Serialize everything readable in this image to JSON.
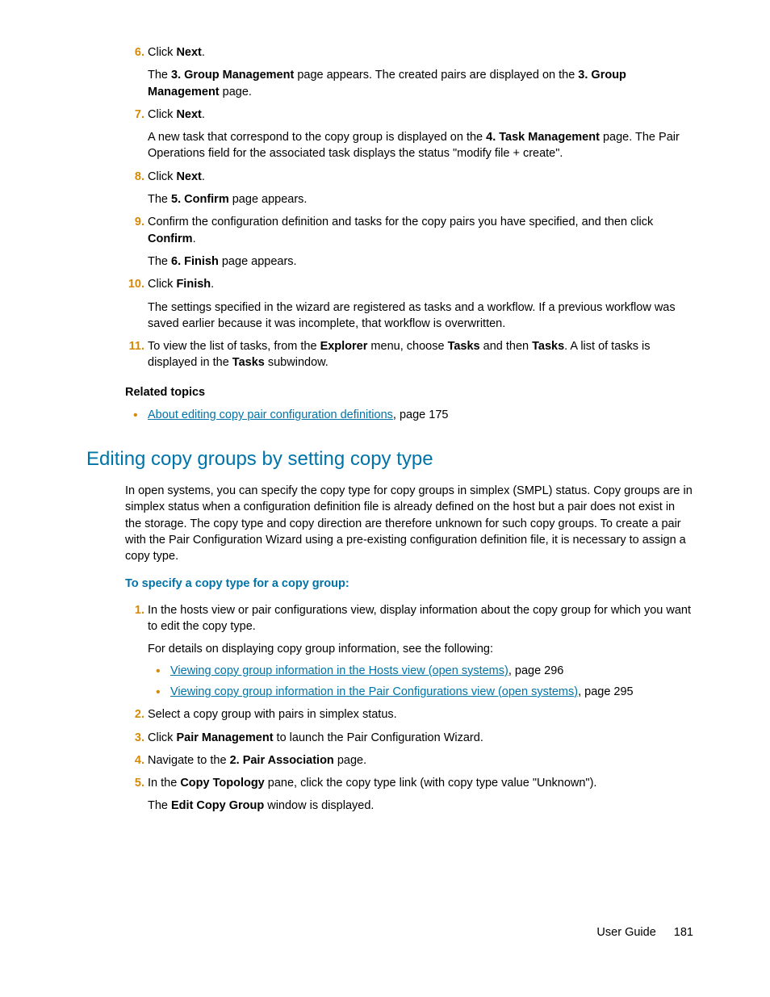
{
  "steps_a": [
    {
      "num": "6.",
      "text": [
        "Click ",
        "Next",
        "."
      ],
      "sub": [
        "The ",
        "3. Group Management",
        " page appears. The created pairs are displayed on the ",
        "3. Group Management",
        " page."
      ]
    },
    {
      "num": "7.",
      "text": [
        "Click ",
        "Next",
        "."
      ],
      "sub_plain": [
        "A new task that correspond to the copy group is displayed on the ",
        "4. Task Management",
        " page. The Pair Operations field for the associated task displays the status \"modify file + create\"."
      ]
    },
    {
      "num": "8.",
      "text": [
        "Click ",
        "Next",
        "."
      ],
      "sub": [
        "The ",
        "5. Confirm",
        " page appears."
      ]
    },
    {
      "num": "9.",
      "text": [
        "Confirm the configuration definition and tasks for the copy pairs you have specified, and then click ",
        "Confirm",
        "."
      ],
      "sub": [
        "The ",
        "6. Finish",
        " page appears."
      ]
    },
    {
      "num": "10.",
      "text": [
        "Click ",
        "Finish",
        "."
      ],
      "sub_plain": [
        "The settings specified in the wizard are registered as tasks and a workflow. If a previous workflow was saved earlier because it was incomplete, that workflow is overwritten."
      ]
    },
    {
      "num": "11.",
      "text": [
        "To view the list of tasks, from the ",
        "Explorer",
        " menu, choose ",
        "Tasks",
        " and then ",
        "Tasks",
        ". A list of tasks is displayed in the ",
        "Tasks",
        " subwindow."
      ]
    }
  ],
  "related_heading": "Related topics",
  "related_link": "About editing copy pair configuration definitions",
  "related_pg": ", page 175",
  "section_heading": "Editing copy groups by setting copy type",
  "intro": "In open systems, you can specify the copy type for copy groups in simplex (SMPL) status. Copy groups are in simplex status when a configuration definition file is already defined on the host but a pair does not exist in the storage.  The copy type and copy direction are therefore unknown for such copy groups. To create a pair with the Pair Configuration Wizard using a pre-existing configuration definition file, it is necessary to assign a copy type.",
  "proc_heading": "To specify a copy type for a copy group:",
  "steps_b": [
    {
      "num": "1.",
      "plain": "In the hosts view or pair configurations view, display information about the copy group for which you want to edit the copy type.",
      "sub_plain": "For details on displaying copy group information, see the following:",
      "links": [
        {
          "t": "Viewing copy group information in the Hosts view (open systems)",
          "pg": ", page 296"
        },
        {
          "t": "Viewing copy group information in the Pair Configurations view (open systems)",
          "pg": ", page 295"
        }
      ]
    },
    {
      "num": "2.",
      "plain": "Select a copy group with pairs in simplex status."
    },
    {
      "num": "3.",
      "text": [
        "Click ",
        "Pair Management",
        " to launch the Pair Configuration Wizard."
      ]
    },
    {
      "num": "4.",
      "text": [
        "Navigate to the ",
        "2. Pair Association",
        " page."
      ]
    },
    {
      "num": "5.",
      "text": [
        "In the ",
        "Copy Topology",
        " pane, click the copy type link (with copy type value \"Unknown\")."
      ],
      "sub": [
        "The ",
        "Edit Copy Group",
        " window is displayed."
      ]
    }
  ],
  "footer_label": "User Guide",
  "footer_page": "181"
}
